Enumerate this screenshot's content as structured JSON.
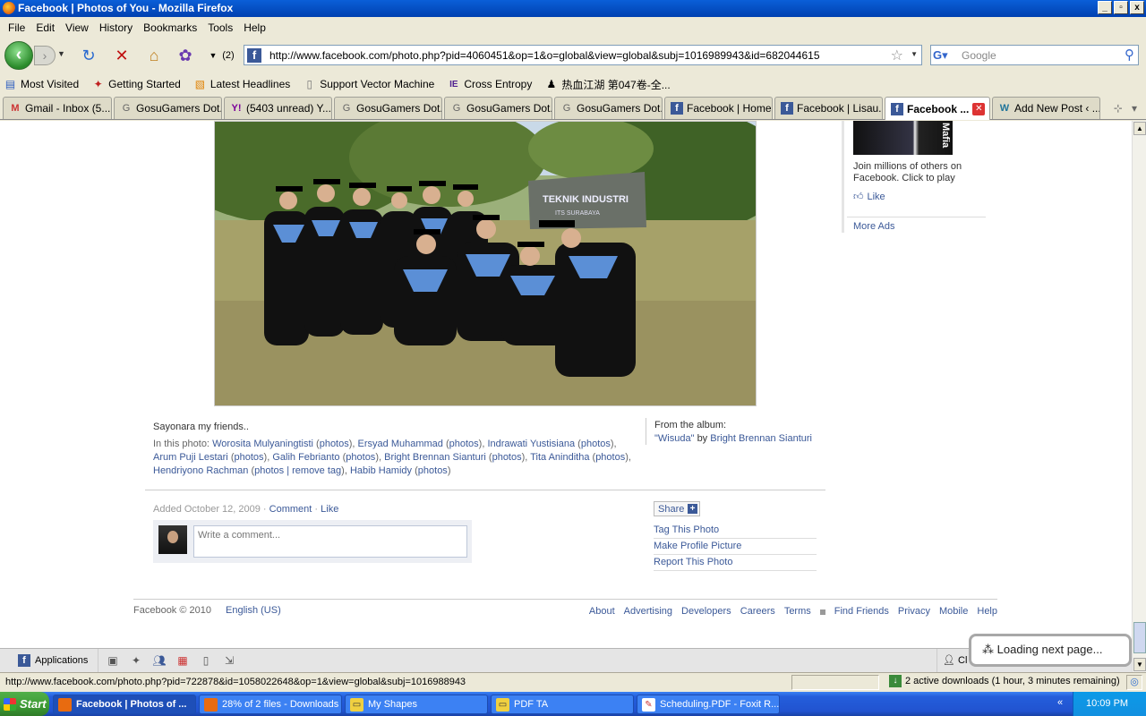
{
  "window": {
    "title": "Facebook | Photos of You - Mozilla Firefox",
    "buttons": [
      "_",
      "▫",
      "x"
    ]
  },
  "menu": [
    "File",
    "Edit",
    "View",
    "History",
    "Bookmarks",
    "Tools",
    "Help"
  ],
  "nav": {
    "back_label": "‹",
    "forward_label": "›",
    "history_count": "(2)",
    "url": "http://www.facebook.com/photo.php?pid=4060451&op=1&o=global&view=global&subj=1016989943&id=682044615",
    "search_placeholder": "Google"
  },
  "bookmarks": [
    {
      "label": "Most Visited",
      "icon": "folder-icon"
    },
    {
      "label": "Getting Started",
      "icon": "firefox-icon"
    },
    {
      "label": "Latest Headlines",
      "icon": "rss-icon"
    },
    {
      "label": "Support Vector Machine",
      "icon": "page-icon"
    },
    {
      "label": "Cross Entropy",
      "icon": "ie-icon"
    },
    {
      "label": "热血江湖 第047卷-全...",
      "icon": "figure-icon"
    }
  ],
  "tabs": [
    {
      "label": "Gmail - Inbox (5...",
      "icon": "M"
    },
    {
      "label": "GosuGamers Dot...",
      "icon": "G"
    },
    {
      "label": "(5403 unread) Y...",
      "icon": "Y!"
    },
    {
      "label": "GosuGamers Dot...",
      "icon": "G"
    },
    {
      "label": "GosuGamers Dot...",
      "icon": "G"
    },
    {
      "label": "GosuGamers Dot...",
      "icon": "G"
    },
    {
      "label": "Facebook | Home",
      "icon": "f"
    },
    {
      "label": "Facebook | Lisau...",
      "icon": "f"
    },
    {
      "label": "Facebook ...",
      "icon": "f",
      "active": true
    },
    {
      "label": "Add New Post ‹ ...",
      "icon": "W"
    }
  ],
  "ad": {
    "brand": "Mafia",
    "text": "Join millions of others on Facebook. Click to play",
    "like": "Like",
    "more_ads": "More Ads"
  },
  "photo_meta": {
    "sign_text": "TEKNIK INDUSTRI",
    "sign_sub": "ITS SURABAYA",
    "caption": "Sayonara my friends..",
    "in_photo_label": "In this photo:",
    "tagged": [
      {
        "name": "Worosita Mulyaningtisti",
        "extra": "photos"
      },
      {
        "name": "Ersyad Muhammad",
        "extra": "photos"
      },
      {
        "name": "Indrawati Yustisiana",
        "extra": "photos"
      },
      {
        "name": "Arum Puji Lestari",
        "extra": "photos"
      },
      {
        "name": "Galih Febrianto",
        "extra": "photos"
      },
      {
        "name": "Bright Brennan Sianturi",
        "extra": "photos"
      },
      {
        "name": "Tita Aninditha",
        "extra": "photos"
      },
      {
        "name": "Hendriyono Rachman",
        "extra": "photos | remove tag"
      },
      {
        "name": "Habib Hamidy",
        "extra": "photos"
      }
    ],
    "album_label": "From the album:",
    "album_name": "\"Wisuda\"",
    "album_by": "by",
    "album_owner": "Bright Brennan Sianturi"
  },
  "actions": {
    "added": "Added October 12, 2009 ·",
    "comment": "Comment",
    "dot": "·",
    "like": "Like",
    "comment_placeholder": "Write a comment...",
    "share": "Share",
    "side": [
      "Tag This Photo",
      "Make Profile Picture",
      "Report This Photo"
    ]
  },
  "footer": {
    "copyright": "Facebook © 2010",
    "language": "English (US)",
    "links_a": [
      "About",
      "Advertising",
      "Developers",
      "Careers",
      "Terms"
    ],
    "links_b": [
      "Find Friends",
      "Privacy",
      "Mobile",
      "Help"
    ]
  },
  "fbbar": {
    "applications": "Applications",
    "chat": "Cl",
    "loading": "Loading next page..."
  },
  "status": {
    "url": "http://www.facebook.com/photo.php?pid=722878&id=1058022648&op=1&view=global&subj=1016988943",
    "downloads": "2 active downloads (1 hour, 3 minutes remaining)"
  },
  "taskbar": {
    "start": "Start",
    "tasks": [
      {
        "label": "Facebook | Photos of ...",
        "active": true
      },
      {
        "label": "28% of 2 files - Downloads"
      },
      {
        "label": "My Shapes"
      },
      {
        "label": "PDF TA"
      },
      {
        "label": "Scheduling.PDF - Foxit R..."
      }
    ],
    "clock": "10:09 PM"
  }
}
